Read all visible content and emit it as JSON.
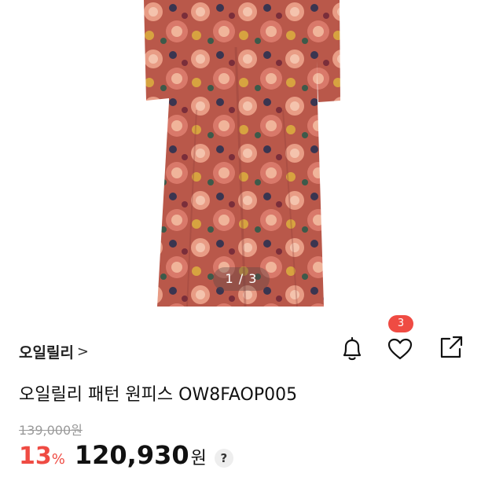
{
  "gallery": {
    "pager_text": "1 / 3",
    "image_icon": "floral-dress-photo"
  },
  "brand": {
    "name": "오일릴리",
    "chevron": ">"
  },
  "actions": {
    "bell_icon": "bell-icon",
    "heart_icon": "heart-icon",
    "share_icon": "share-icon",
    "like_count": "3"
  },
  "product": {
    "title": "오일릴리 패턴 원피스 OW8FAOP005",
    "original_price": "139,000원",
    "discount": "13",
    "discount_unit": "%",
    "price": "120,930",
    "currency": "원",
    "help_label": "?"
  },
  "colors": {
    "accent_red": "#ef4b43",
    "muted_gray": "#9a9a9a"
  }
}
